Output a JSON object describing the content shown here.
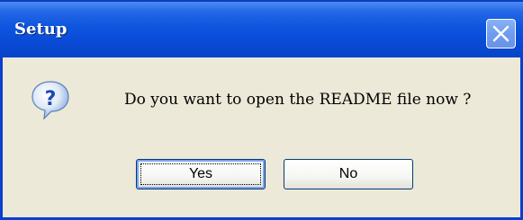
{
  "window": {
    "title": "Setup",
    "close_icon": "close-icon"
  },
  "dialog": {
    "icon": "question-icon",
    "message": "Do you want to open the README file now ?",
    "buttons": {
      "yes_label": "Yes",
      "no_label": "No"
    },
    "default_button": "Yes"
  },
  "colors": {
    "titlebar": "#0a4bd7",
    "body": "#ece9d8",
    "close_button": "#6f9cf0",
    "button_border": "#003c74"
  }
}
